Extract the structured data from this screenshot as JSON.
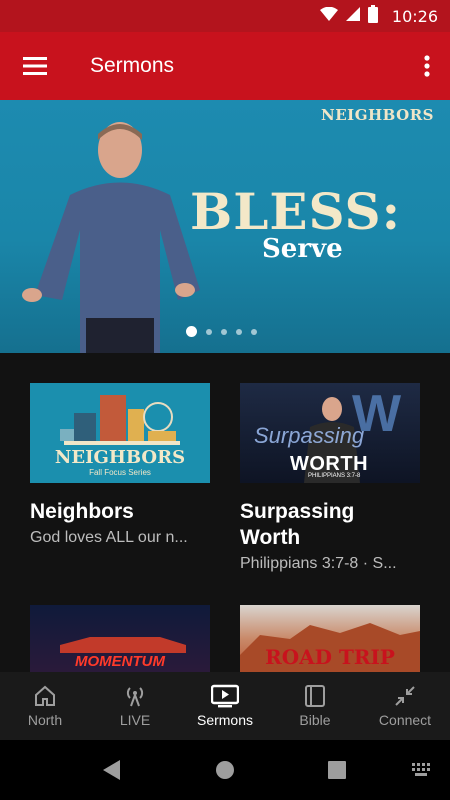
{
  "status_bar": {
    "time": "10:26"
  },
  "app_bar": {
    "title": "Sermons"
  },
  "hero": {
    "brand": "NEIGHBORS",
    "title": "BLESS:",
    "subtitle": "Serve",
    "slide_count": 5,
    "active_slide": 1
  },
  "cards": [
    {
      "title": "Neighbors",
      "description": "God loves ALL our n...",
      "thumb_text": "NEIGHBORS",
      "thumb_subtext": "Fall Focus Series"
    },
    {
      "title": "Surpassing Worth",
      "description": "Philippians 3:7-8 · S...",
      "thumb_text": "WORTH",
      "thumb_subtext": "PHILIPPIANS 3:7-8"
    },
    {
      "title": "",
      "description": "",
      "thumb_text": "MOMENTUM"
    },
    {
      "title": "",
      "description": "",
      "thumb_text": "ROAD TRIP"
    }
  ],
  "bottom_nav": [
    {
      "label": "North",
      "icon": "home-icon"
    },
    {
      "label": "LIVE",
      "icon": "broadcast-icon"
    },
    {
      "label": "Sermons",
      "icon": "video-icon",
      "active": true
    },
    {
      "label": "Bible",
      "icon": "book-icon"
    },
    {
      "label": "Connect",
      "icon": "collapse-arrows-icon"
    }
  ],
  "colors": {
    "primary": "#c8121d",
    "status": "#b3141d",
    "background": "#121212",
    "nav": "#1a1a1a"
  }
}
